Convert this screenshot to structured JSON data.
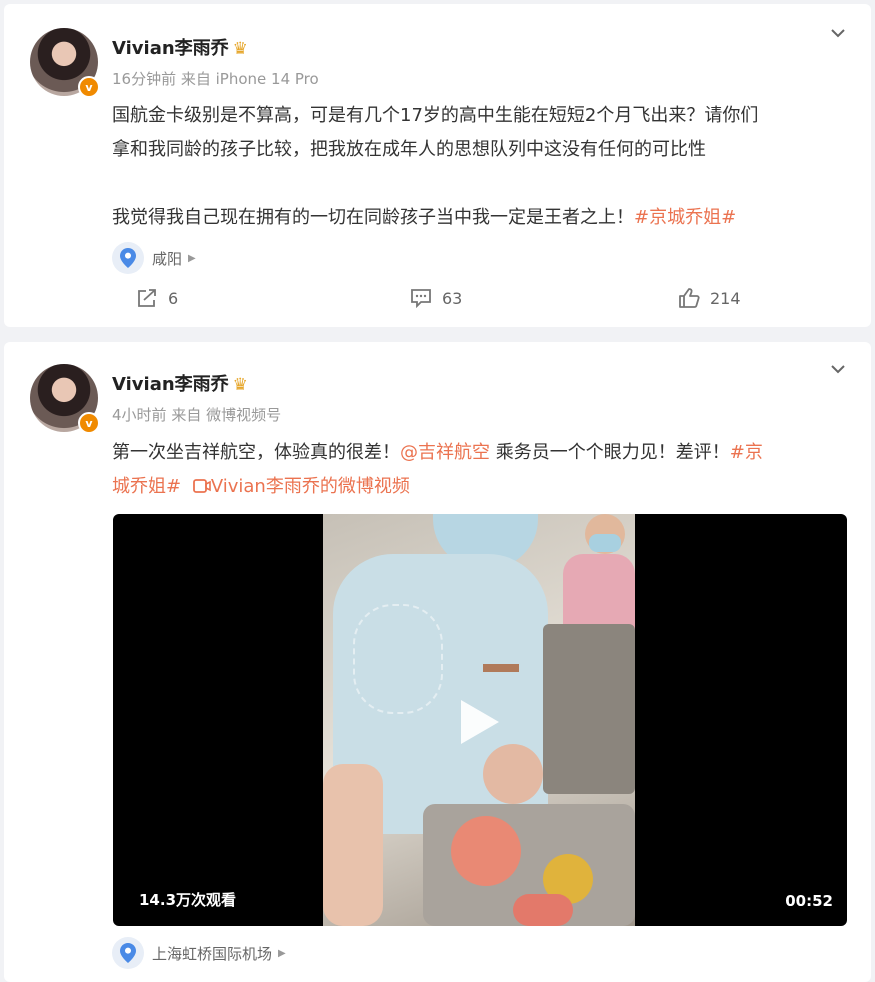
{
  "posts": [
    {
      "username": "Vivian李雨乔",
      "time": "16分钟前",
      "source": "来自 iPhone 14 Pro",
      "verified_badge": "v",
      "text_line1": "国航金卡级别是不算高，可是有几个17岁的高中生能在短短2个月飞出来？请你们",
      "text_line2": "拿和我同龄的孩子比较，把我放在成年人的思想队列中这没有任何的可比性",
      "text_line3": "我觉得我自己现在拥有的一切在同龄孩子当中我一定是王者之上！",
      "hashtag": "#京城乔姐#",
      "location": "咸阳",
      "reposts": "6",
      "comments": "63",
      "likes": "214"
    },
    {
      "username": "Vivian李雨乔",
      "time": "4小时前",
      "source": "来自 微博视频号",
      "verified_badge": "v",
      "text_part1": "第一次坐吉祥航空，体验真的很差！",
      "mention": "@吉祥航空",
      "text_part2": " 乘务员一个个眼力见！差评！",
      "hashtag_part1": "#京",
      "hashtag_part2": "城乔姐#",
      "video_link": "Vivian李雨乔的微博视频",
      "video_views": "14.3万次观看",
      "video_duration": "00:52",
      "location": "上海虹桥国际机场"
    }
  ],
  "colors": {
    "accent": "#eb7350",
    "meta": "#999999",
    "pin": "#4a8ae6",
    "badge": "#f08a00"
  },
  "icons": [
    "chevron-down-icon",
    "crown-icon",
    "location-pin-icon",
    "repost-icon",
    "comment-icon",
    "like-icon",
    "play-icon",
    "video-link-icon"
  ]
}
